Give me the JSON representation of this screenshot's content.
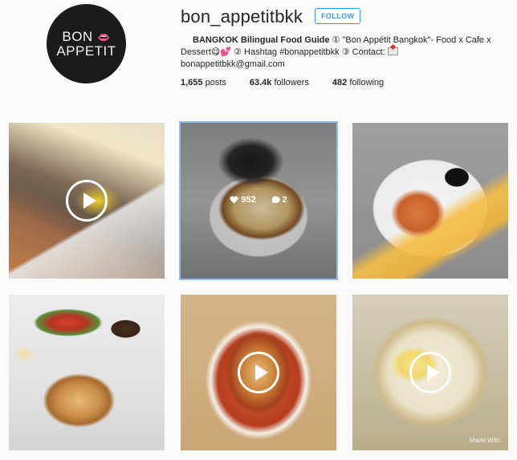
{
  "profile": {
    "username": "bon_appetitbkk",
    "follow_label": "FOLLOW",
    "avatar_logo_line1": "BON",
    "avatar_logo_line2": "APPETIT",
    "bio_name": "BANGKOK Bilingual Food Guide",
    "bio_line1_rest": " ① \"Bon Appétit Bangkok\"- Food x Cafe x",
    "bio_line2": "Dessert😋💕 ② Hashtag #bonappetitbkk ③ Contact: ",
    "bio_line3": "bonappetitbkk@gmail.com",
    "stats": [
      {
        "num": "1,655",
        "label": "posts"
      },
      {
        "num": "63.4k",
        "label": "followers"
      },
      {
        "num": "482",
        "label": "following"
      }
    ]
  },
  "hover": {
    "likes": "952",
    "comments": "2"
  },
  "watermark": "Made With"
}
